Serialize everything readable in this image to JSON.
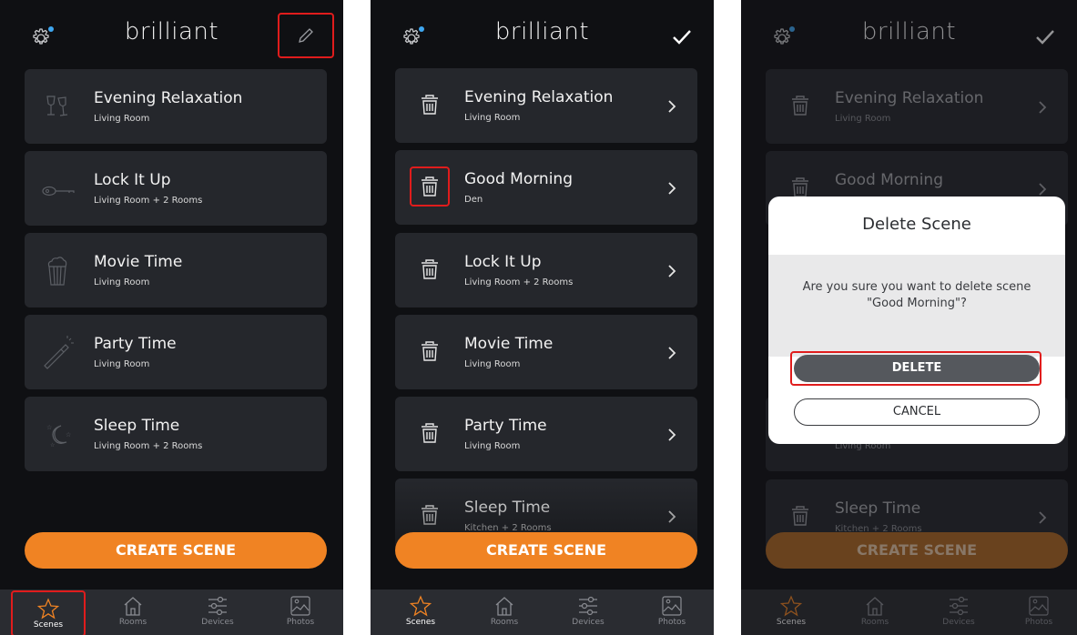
{
  "app": {
    "logo": "brilliant",
    "accent": "#f08323"
  },
  "screens": {
    "one": {
      "scenes": [
        {
          "title": "Evening Relaxation",
          "subtitle": "Living Room",
          "icon": "wine-glasses-icon"
        },
        {
          "title": "Lock It Up",
          "subtitle": "Living Room + 2 Rooms",
          "icon": "key-icon"
        },
        {
          "title": "Movie Time",
          "subtitle": "Living Room",
          "icon": "popcorn-icon"
        },
        {
          "title": "Party Time",
          "subtitle": "Living Room",
          "icon": "champagne-icon"
        },
        {
          "title": "Sleep Time",
          "subtitle": "Living Room + 2 Rooms",
          "icon": "moon-stars-icon"
        }
      ]
    },
    "two": {
      "scenes": [
        {
          "title": "Evening Relaxation",
          "subtitle": "Living Room"
        },
        {
          "title": "Good Morning",
          "subtitle": "Den"
        },
        {
          "title": "Lock It Up",
          "subtitle": "Living Room + 2 Rooms"
        },
        {
          "title": "Movie Time",
          "subtitle": "Living Room"
        },
        {
          "title": "Party Time",
          "subtitle": "Living Room"
        },
        {
          "title": "Sleep Time",
          "subtitle": "Kitchen + 2 Rooms"
        }
      ]
    },
    "three": {
      "scenes": [
        {
          "title": "Evening Relaxation",
          "subtitle": "Living Room"
        },
        {
          "title": "Good Morning",
          "subtitle": ""
        },
        {
          "title": "",
          "subtitle": "Living Room"
        },
        {
          "title": "Sleep Time",
          "subtitle": "Kitchen + 2 Rooms"
        }
      ],
      "dialog": {
        "title": "Delete Scene",
        "message_line1": "Are you sure you want to delete scene",
        "message_line2": "\"Good Morning\"?",
        "delete_label": "DELETE",
        "cancel_label": "CANCEL"
      }
    }
  },
  "create_label": "CREATE SCENE",
  "tabs": {
    "scenes": "Scenes",
    "rooms": "Rooms",
    "devices": "Devices",
    "photos": "Photos"
  }
}
